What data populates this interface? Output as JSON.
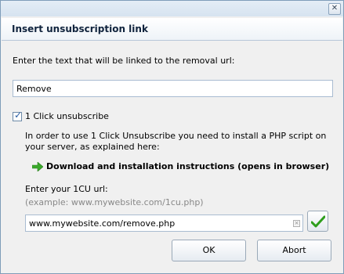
{
  "window": {
    "close_glyph": "✕"
  },
  "header": {
    "title": "Insert unsubscription link"
  },
  "prompt": {
    "label": "Enter the text that will be linked to the removal url:"
  },
  "link_text": {
    "value": "Remove"
  },
  "one_click": {
    "checked": true,
    "label": "1 Click unsubscribe",
    "info": "In order to use 1 Click Unsubscribe you need to install a PHP script on your server, as explained here:",
    "download_label": "Download and installation instructions (opens in browser)",
    "url_label": "Enter your 1CU url:",
    "example": "(example: www.mywebsite.com/1cu.php)",
    "url_value": "www.mywebsite.com/remove.php"
  },
  "buttons": {
    "ok": "OK",
    "abort": "Abort"
  },
  "colors": {
    "accent_green": "#2e9e1c",
    "link_arrow": "#3aa82a"
  },
  "icons": [
    "close-icon",
    "arrow-right-icon",
    "clear-icon",
    "checkmark-icon",
    "checkbox-icon"
  ]
}
